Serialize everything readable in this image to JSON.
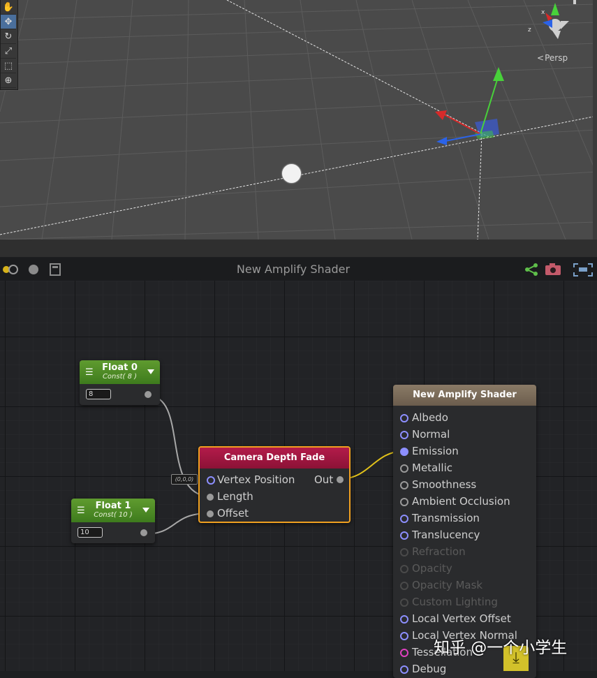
{
  "scene": {
    "view_mode": "Persp",
    "tools": [
      "hand-icon",
      "move-icon",
      "rotate-icon",
      "scale-icon",
      "rect-icon",
      "transform-icon"
    ],
    "gizmo_labels": {
      "x": "x",
      "z": "z"
    },
    "colors": {
      "x_axis": "#d62a2a",
      "y_axis": "#48d13a",
      "z_axis": "#2b63e8",
      "grid_bg": "#4a4a4a"
    }
  },
  "graph": {
    "title": "New Amplify Shader",
    "toolbar_icons": [
      "live-icon",
      "record-icon",
      "calculator-icon",
      "share-icon",
      "camera-icon",
      "maximize-icon"
    ],
    "nodes": {
      "float0": {
        "name": "Float 0",
        "sub": "Const( 8 )",
        "value": "8"
      },
      "float1": {
        "name": "Float 1",
        "sub": "Const( 10 )",
        "value": "10"
      },
      "cdf": {
        "title": "Camera Depth Fade",
        "inputs": [
          "Vertex Position",
          "Length",
          "Offset"
        ],
        "output": "Out",
        "default_tag": "(0,0,0)"
      },
      "master": {
        "title": "New Amplify Shader",
        "ports": [
          {
            "label": "Albedo",
            "style": "ring"
          },
          {
            "label": "Normal",
            "style": "ring"
          },
          {
            "label": "Emission",
            "style": "filled"
          },
          {
            "label": "Metallic",
            "style": "gray"
          },
          {
            "label": "Smoothness",
            "style": "gray"
          },
          {
            "label": "Ambient Occlusion",
            "style": "gray"
          },
          {
            "label": "Transmission",
            "style": "ring"
          },
          {
            "label": "Translucency",
            "style": "ring"
          },
          {
            "label": "Refraction",
            "style": "dim"
          },
          {
            "label": "Opacity",
            "style": "dim"
          },
          {
            "label": "Opacity Mask",
            "style": "dim"
          },
          {
            "label": "Custom Lighting",
            "style": "dim"
          },
          {
            "label": "Local Vertex Offset",
            "style": "ring"
          },
          {
            "label": "Local Vertex Normal",
            "style": "ring"
          },
          {
            "label": "Tessellation",
            "style": "pink"
          },
          {
            "label": "Debug",
            "style": "ring"
          }
        ]
      }
    },
    "colors": {
      "selection": "#f0a020",
      "wire": "#a8a8a8",
      "wire_active": "#e2c21a",
      "port_vector": "#8d8fff"
    }
  },
  "watermark": "知乎 @一个小学生"
}
